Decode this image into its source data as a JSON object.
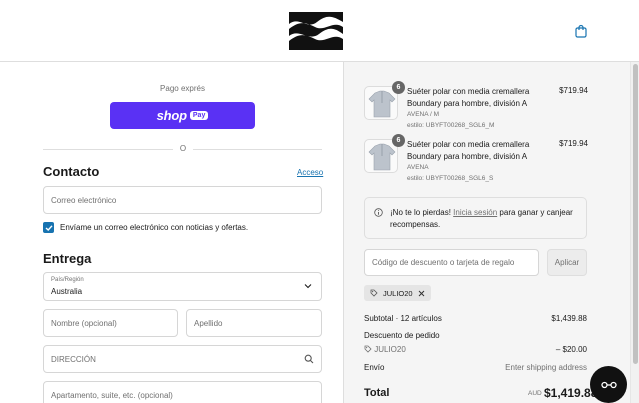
{
  "header": {
    "brand_icon": "billabong-wave-logo",
    "cart_icon": "shopping-bag-icon"
  },
  "express": {
    "label": "Pago exprés",
    "shop_label": "shop",
    "pay_label": "Pay",
    "divider": "O"
  },
  "contact": {
    "title": "Contacto",
    "login_link": "Acceso",
    "email_placeholder": "Correo electrónico",
    "newsletter_checked": true,
    "newsletter_label": "Envíame un correo electrónico con noticias y ofertas."
  },
  "delivery": {
    "title": "Entrega",
    "country_label": "País/Región",
    "country_value": "Australia",
    "first_name_placeholder": "Nombre (opcional)",
    "last_name_placeholder": "Apellido",
    "address_placeholder": "DIRECCIÓN",
    "apartment_placeholder": "Apartamento, suite, etc. (opcional)"
  },
  "cart": {
    "items": [
      {
        "qty": "6",
        "name": "Suéter polar con media cremallera Boundary para hombre, división A",
        "variant": "AVENA / M",
        "sku": "estilo: UBYFT00268_SGL6_M",
        "price": "$719.94"
      },
      {
        "qty": "6",
        "name": "Suéter polar con media cremallera Boundary para hombre, división A",
        "variant": "AVENA",
        "sku": "estilo: UBYFT00268_SGL6_S",
        "price": "$719.94"
      }
    ],
    "promo_prefix": "¡No te lo pierdas!",
    "promo_link": "Inicia sesión",
    "promo_suffix": "para ganar y canjear recompensas.",
    "discount_placeholder": "Código de descuento o tarjeta de regalo",
    "apply_label": "Aplicar",
    "applied_code": "JULIO20",
    "subtotal_label": "Subtotal · 12 artículos",
    "subtotal_value": "$1,439.88",
    "order_discount_label": "Descuento de pedido",
    "order_discount_code": "JULIO20",
    "order_discount_value": "– $20.00",
    "shipping_label": "Envío",
    "shipping_value": "Enter shipping address",
    "total_label": "Total",
    "total_currency": "AUD",
    "total_value": "$1,419.88"
  },
  "colors": {
    "shop_pay": "#5a31f4",
    "link": "#1773b0",
    "summary_bg": "#f5f5f5"
  }
}
